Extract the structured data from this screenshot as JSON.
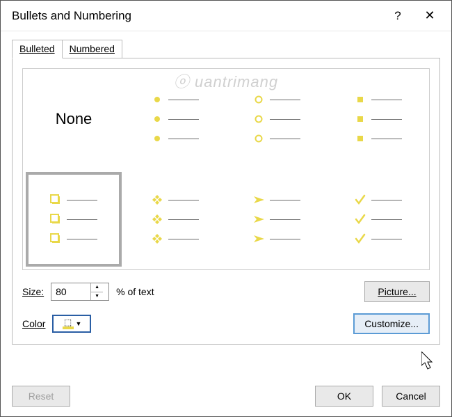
{
  "dialog": {
    "title": "Bullets and Numbering",
    "help": "?",
    "close": "✕"
  },
  "tabs": {
    "bulleted": "Bulleted",
    "numbered": "Numbered"
  },
  "none_label": "None",
  "controls": {
    "size_label": "Size:",
    "size_value": "80",
    "percent_of_text": "% of text",
    "color_label": "Color",
    "picture": "Picture...",
    "customize": "Customize..."
  },
  "footer": {
    "reset": "Reset",
    "ok": "OK",
    "cancel": "Cancel"
  },
  "colors": {
    "bullet": "#e9d849",
    "bullet_dark": "#d4c441"
  },
  "watermark": "ⓞ uantrimang"
}
